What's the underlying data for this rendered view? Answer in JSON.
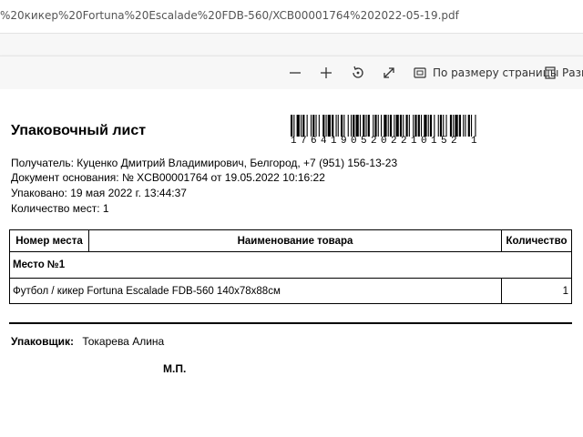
{
  "browser": {
    "url": "%20кикер%20Fortuna%20Escalade%20FDB-560/XCB00001764%202022-05-19.pdf"
  },
  "pdf_toolbar": {
    "icons": [
      "zoom-out-icon",
      "zoom-in-icon",
      "rotate-icon",
      "fullscreen-icon",
      "fit-page-icon",
      "page-view-icon"
    ],
    "fit_page_label": "По размеру страницы",
    "page_view_label": "Разм"
  },
  "document": {
    "title": "Упаковочный лист",
    "barcode_number": "17641905202210152 1",
    "recipient": "Получатель: Куценко Дмитрий Владимирович, Белгород, +7 (951) 156-13-23",
    "basis_document": "Документ основания: № XCB00001764 от 19.05.2022 10:16:22",
    "packed": "Упаковано: 19 мая 2022 г. 13:44:37",
    "places_count": "Количество мест: 1",
    "table": {
      "headers": [
        "Номер места",
        "Наименование товара",
        "Количество"
      ],
      "place_label": "Место №1",
      "rows": [
        {
          "name": "Футбол / кикер Fortuna Escalade FDB-560 140х78х88см",
          "qty": "1"
        }
      ]
    },
    "packer_label": "Упаковщик:",
    "packer_name": "Токарева Алина",
    "stamp": "М.П."
  }
}
